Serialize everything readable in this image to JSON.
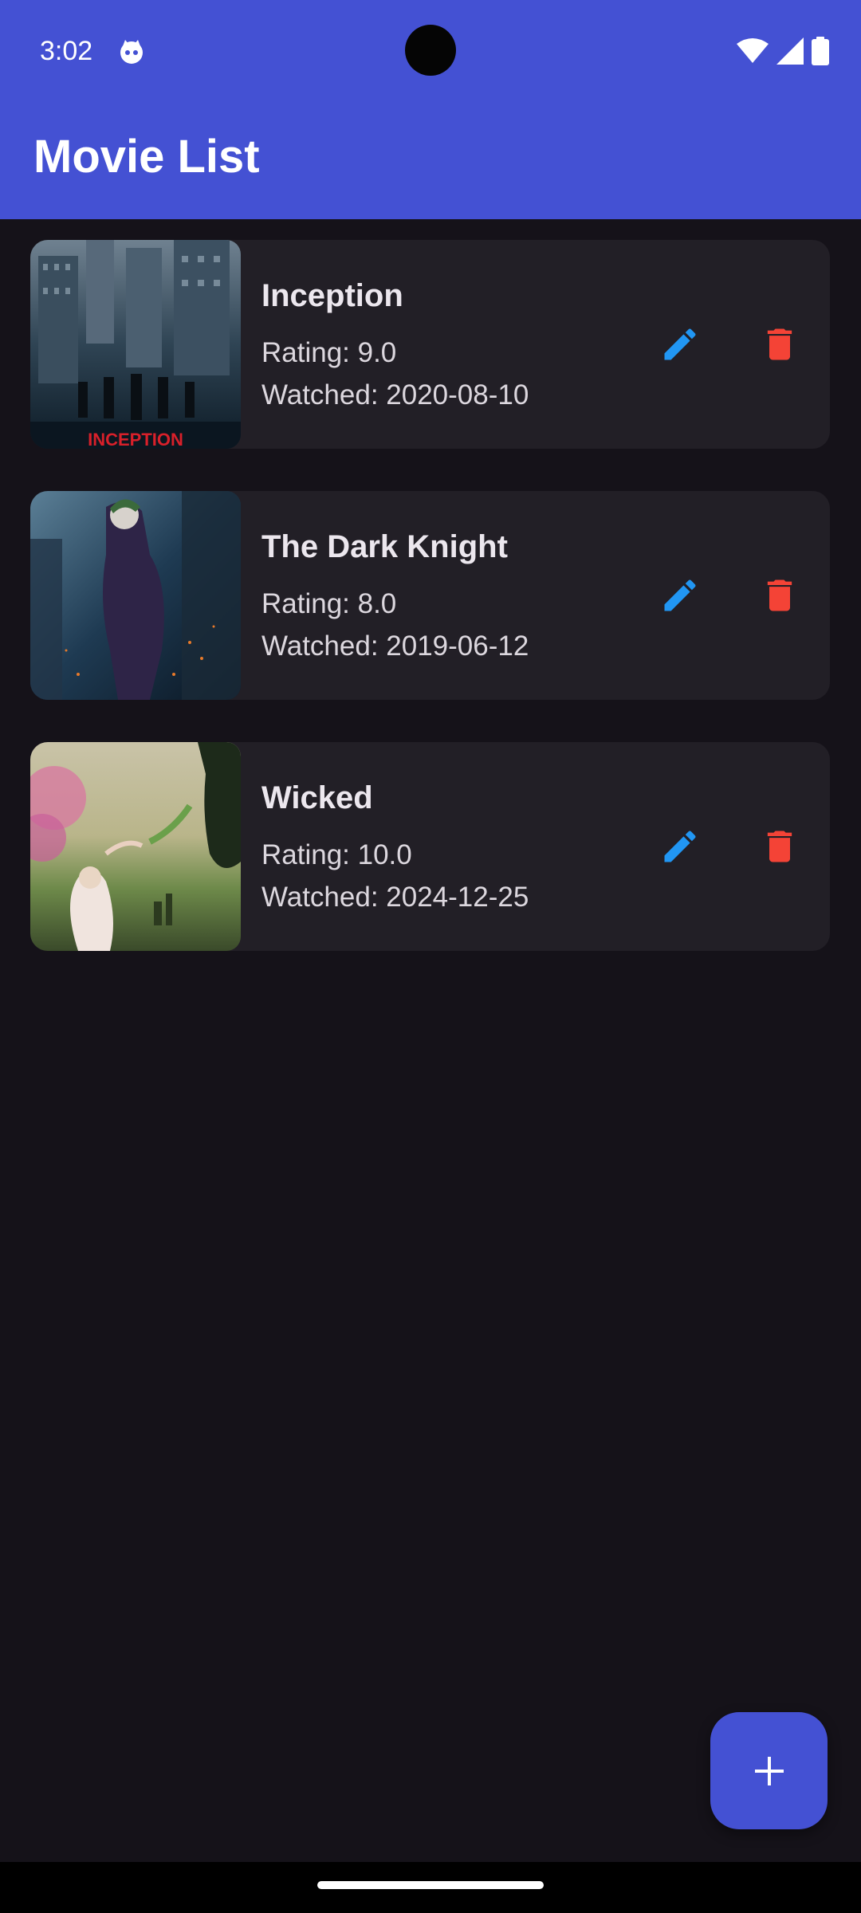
{
  "status_bar": {
    "time": "3:02"
  },
  "app_bar": {
    "title": "Movie List"
  },
  "movies": [
    {
      "title": "Inception",
      "rating_text": "Rating: 9.0",
      "watched_text": "Watched: 2020-08-10",
      "poster_caption": "INCEPTION"
    },
    {
      "title": "The Dark Knight",
      "rating_text": "Rating: 8.0",
      "watched_text": "Watched: 2019-06-12"
    },
    {
      "title": "Wicked",
      "rating_text": "Rating: 10.0",
      "watched_text": "Watched: 2024-12-25"
    }
  ],
  "icons": {
    "edit": "pencil-icon",
    "delete": "trash-icon",
    "add": "plus-icon"
  },
  "colors": {
    "primary": "#4451d3",
    "background": "#151219",
    "card": "#221f26",
    "edit": "#2196f3",
    "delete": "#f44336"
  }
}
